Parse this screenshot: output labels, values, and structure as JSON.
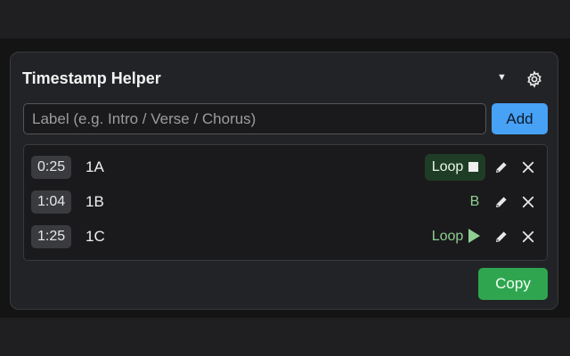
{
  "header": {
    "title": "Timestamp Helper",
    "dropdown_icon": "caret-down-icon",
    "settings_icon": "gear-icon"
  },
  "form": {
    "label_placeholder": "Label (e.g. Intro / Verse / Chorus)",
    "label_value": "",
    "add_label": "Add"
  },
  "timestamps": [
    {
      "time": "0:25",
      "label": "1A",
      "loop_text": "Loop",
      "loop_state": "active",
      "loop_icon": "stop-icon"
    },
    {
      "time": "1:04",
      "label": "1B",
      "loop_text": "B",
      "loop_state": "end-marker",
      "loop_icon": ""
    },
    {
      "time": "1:25",
      "label": "1C",
      "loop_text": "Loop",
      "loop_state": "idle",
      "loop_icon": "play-icon"
    }
  ],
  "row_actions": {
    "edit_icon": "pencil-icon",
    "delete_icon": "close-icon"
  },
  "footer": {
    "copy_label": "Copy"
  },
  "colors": {
    "add_button": "#47a1f5",
    "copy_button": "#2fa550",
    "loop_active_bg": "#1f3d26",
    "loop_text": "#8fcf92"
  }
}
